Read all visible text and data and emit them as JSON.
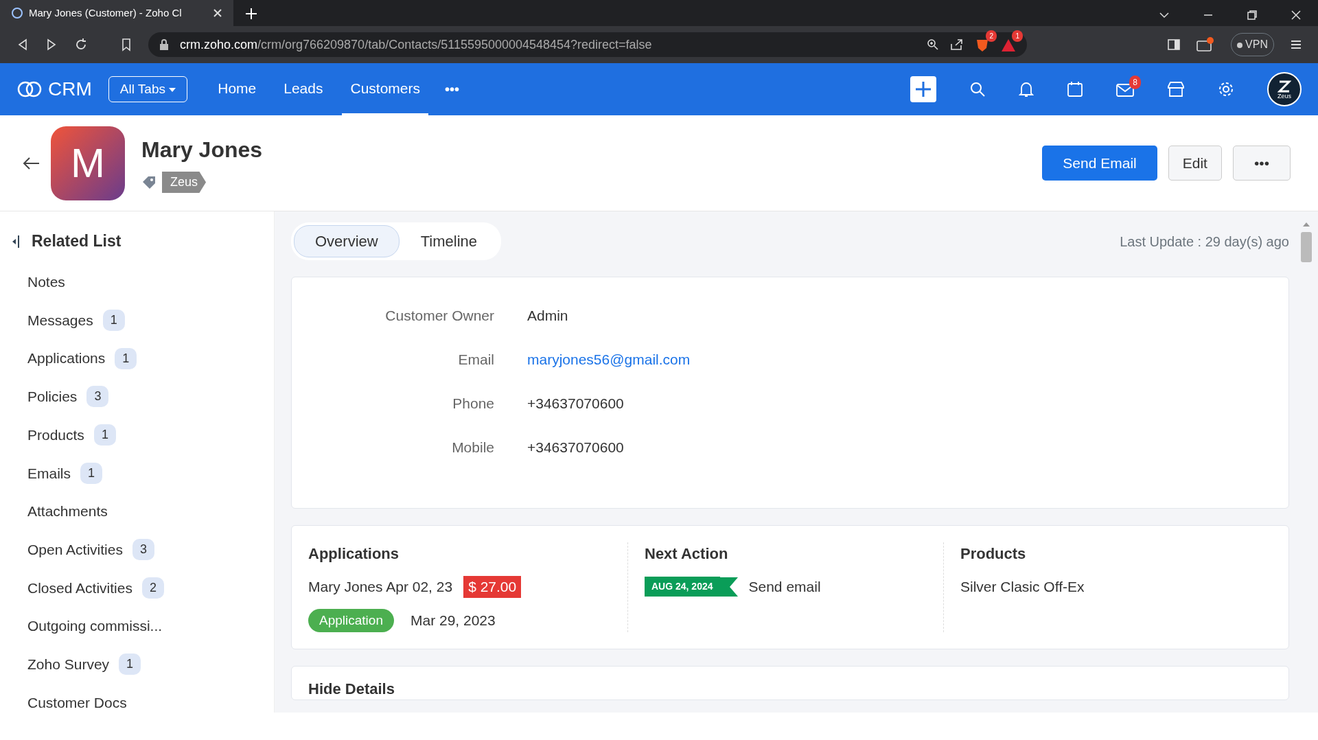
{
  "browser": {
    "tab_title": "Mary Jones (Customer) - Zoho Cl",
    "url_host": "crm.zoho.com",
    "url_path": "/crm/org766209870/tab/Contacts/5115595000004548454?redirect=false",
    "extension_badges": [
      "2",
      "1"
    ],
    "vpn": "VPN"
  },
  "navbar": {
    "brand": "CRM",
    "all_tabs": "All Tabs",
    "tabs": [
      {
        "label": "Home",
        "selected": false
      },
      {
        "label": "Leads",
        "selected": false
      },
      {
        "label": "Customers",
        "selected": true
      }
    ],
    "more": "•••",
    "mail_badge": "8",
    "avatar_label": "Zeus"
  },
  "record": {
    "initial": "M",
    "name": "Mary Jones",
    "tag": "Zeus",
    "buttons": [
      {
        "label": "Send Email",
        "kind": "primary"
      },
      {
        "label": "Edit",
        "kind": "secondary"
      },
      {
        "label": "•••",
        "kind": "secondary"
      }
    ]
  },
  "sidebar": {
    "title": "Related List",
    "items": [
      {
        "label": "Notes"
      },
      {
        "label": "Messages",
        "count": "1"
      },
      {
        "label": "Applications",
        "count": "1"
      },
      {
        "label": "Policies",
        "count": "3"
      },
      {
        "label": "Products",
        "count": "1"
      },
      {
        "label": "Emails",
        "count": "1"
      },
      {
        "label": "Attachments"
      },
      {
        "label": "Open Activities",
        "count": "3"
      },
      {
        "label": "Closed Activities",
        "count": "2"
      },
      {
        "label": "Outgoing commissi..."
      },
      {
        "label": "Zoho Survey",
        "count": "1"
      },
      {
        "label": "Customer Docs"
      }
    ]
  },
  "view_tabs": [
    {
      "label": "Overview",
      "selected": true
    },
    {
      "label": "Timeline",
      "selected": false
    }
  ],
  "last_update": "Last Update : 29 day(s) ago",
  "fields": [
    {
      "label": "Customer Owner",
      "value": "Admin",
      "kind": "text"
    },
    {
      "label": "Email",
      "value": "maryjones56@gmail.com",
      "kind": "link"
    },
    {
      "label": "Phone",
      "value": "+34637070600",
      "kind": "text"
    },
    {
      "label": "Mobile",
      "value": "+34637070600",
      "kind": "text"
    }
  ],
  "summary": {
    "applications": {
      "title": "Applications",
      "record": "Mary Jones Apr 02, 23",
      "amount": "$ 27.00",
      "status": "Application",
      "date": "Mar 29, 2023"
    },
    "next_action": {
      "title": "Next Action",
      "date": "AUG 24, 2024",
      "action": "Send email"
    },
    "products": {
      "title": "Products",
      "item": "Silver Clasic Off-Ex"
    }
  },
  "hide_details": "Hide Details"
}
